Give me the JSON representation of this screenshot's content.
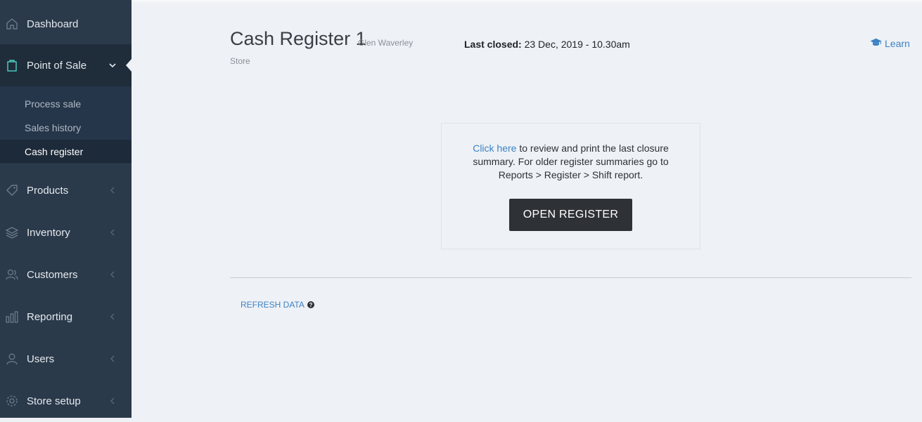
{
  "sidebar": {
    "items": [
      {
        "label": "Dashboard",
        "icon": "home-icon"
      },
      {
        "label": "Point of Sale",
        "icon": "shopping-bag-icon"
      },
      {
        "label": "Products",
        "icon": "tag-icon"
      },
      {
        "label": "Inventory",
        "icon": "layers-icon"
      },
      {
        "label": "Customers",
        "icon": "users-icon"
      },
      {
        "label": "Reporting",
        "icon": "bar-chart-icon"
      },
      {
        "label": "Users",
        "icon": "user-icon"
      },
      {
        "label": "Store setup",
        "icon": "gear-icon"
      }
    ],
    "submenu": [
      {
        "label": "Process sale"
      },
      {
        "label": "Sales history"
      },
      {
        "label": "Cash register"
      }
    ]
  },
  "header": {
    "title": "Cash Register 1",
    "store_line1": "Glen Waverley",
    "store_line2": "Store",
    "last_closed_label": "Last closed:",
    "last_closed_value": "23 Dec, 2019 - 10.30am",
    "learn_label": "Learn"
  },
  "panel": {
    "link_text": "Click here",
    "text_line1": "to review and print the last closure",
    "text_line2": "summary. For older register summaries go to",
    "text_line3": "Reports > Register > Shift report.",
    "button_label": "OPEN REGISTER"
  },
  "footer": {
    "refresh_label": "REFRESH DATA"
  },
  "colors": {
    "sidebar_bg": "#2b3a4a",
    "accent_link": "#3d82c4",
    "active_icon": "#4fd1c5",
    "button_bg": "#2e3237"
  }
}
